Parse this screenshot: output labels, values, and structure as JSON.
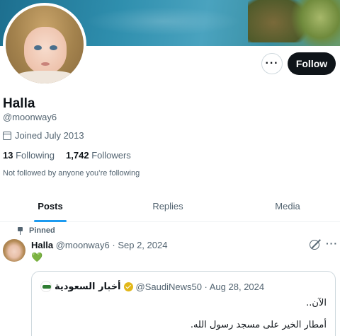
{
  "profile": {
    "name": "Halla",
    "handle": "@moonway6",
    "joined": "Joined July 2013",
    "following_count": "13",
    "following_label": "Following",
    "followers_count": "1,742",
    "followers_label": "Followers",
    "not_followed": "Not followed by anyone you’re following"
  },
  "actions": {
    "more_label": "···",
    "follow_label": "Follow"
  },
  "tabs": [
    {
      "label": "Posts",
      "active": true
    },
    {
      "label": "Replies",
      "active": false
    },
    {
      "label": "Media",
      "active": false
    }
  ],
  "post": {
    "pinned_label": "Pinned",
    "author_name": "Halla",
    "meta": "@moonway6 · Sep 2, 2024",
    "content": "💚",
    "more_label": "···",
    "quote": {
      "author_name": "أخبار السعودية",
      "meta": "@SaudiNews50 · Aug 28, 2024",
      "line1": "الآن..",
      "line2": "أمطار الخير على مسجد رسول الله."
    }
  },
  "colors": {
    "accent": "#1d9bf0",
    "follow_button": "#0f1419",
    "verified_badge": "#e2b719"
  }
}
